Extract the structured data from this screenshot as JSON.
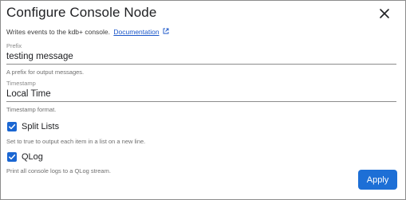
{
  "dialog": {
    "title": "Configure Console Node",
    "close_icon": "close-icon",
    "description": "Writes events to the kdb+ console.",
    "doc_link": "Documentation",
    "doc_link_icon": "external-link-icon"
  },
  "fields": {
    "prefix": {
      "label": "Prefix",
      "value": "testing message",
      "hint": "A prefix for output messages."
    },
    "timestamp": {
      "label": "Timestamp",
      "value": "Local Time",
      "hint": "Timestamp format."
    }
  },
  "options": {
    "split_lists": {
      "label": "Split Lists",
      "checked": true,
      "hint": "Set to true to output each item in a list on a new line."
    },
    "qlog": {
      "label": "QLog",
      "checked": true,
      "hint": "Print all console logs to a QLog stream."
    }
  },
  "actions": {
    "apply_label": "Apply"
  },
  "colors": {
    "accent": "#1d6fd6",
    "link": "#1a56c9"
  }
}
